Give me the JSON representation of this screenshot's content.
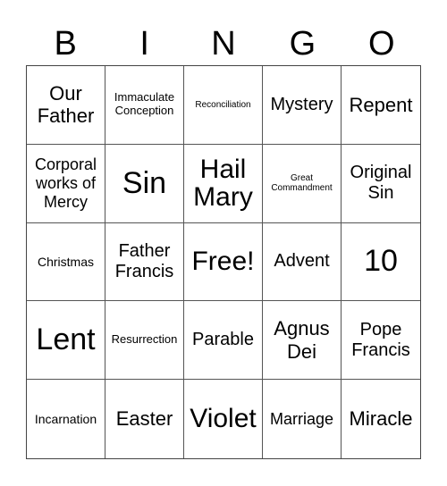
{
  "header": {
    "letters": [
      "B",
      "I",
      "N",
      "G",
      "O"
    ]
  },
  "grid": {
    "rows": [
      [
        "Our Father",
        "Immaculate Conception",
        "Reconciliation",
        "Mystery",
        "Repent"
      ],
      [
        "Corporal works of Mercy",
        "Sin",
        "Hail Mary",
        "Great Commandment",
        "Original Sin"
      ],
      [
        "Christmas",
        "Father Francis",
        "Free!",
        "Advent",
        "10"
      ],
      [
        "Lent",
        "Resurrection",
        "Parable",
        "Agnus Dei",
        "Pope Francis"
      ],
      [
        "Incarnation",
        "Easter",
        "Violet",
        "Marriage",
        "Miracle"
      ]
    ]
  },
  "colors": {
    "text": "#000000",
    "grid_line": "#555555",
    "background": "#ffffff"
  }
}
